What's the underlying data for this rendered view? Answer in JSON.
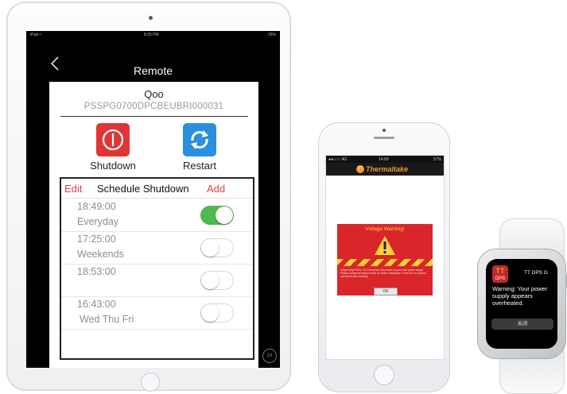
{
  "ipad": {
    "status": {
      "left": "iPad ≈",
      "time": "8:25 PM",
      "right": "25%"
    },
    "nav_title": "Remote",
    "device_name": "Qoo",
    "device_serial": "PSSPG0700DPCBEUBRI000031",
    "actions": {
      "shutdown": "Shutdown",
      "restart": "Restart"
    },
    "schedule": {
      "edit": "Edit",
      "title": "Schedule Shutdown",
      "add": "Add",
      "rows": [
        {
          "time": "18:49:00",
          "days": "Everyday",
          "enabled": true
        },
        {
          "time": "17:25:00",
          "days": "Weekends",
          "enabled": false
        },
        {
          "time": "18:53:00",
          "days": "",
          "enabled": false
        },
        {
          "time": "16:43:00",
          "days": "Wed Thu Fri",
          "enabled": false
        }
      ]
    },
    "zoom_badge": "1X"
  },
  "iphone": {
    "status": {
      "left": "●●○○○ 4G",
      "time": "14:00",
      "right": "57%"
    },
    "brand": "Thermaltake",
    "brand_logo": "TT",
    "warning": {
      "title": "Voltage Warning!",
      "body": "Output stop:PSU's +12V abnormal, which wire on your read power supply. Please contact technical service for further assistance. Press OK to continue operations after warning.",
      "ok": "OK"
    }
  },
  "watch": {
    "icon_tt": "TT",
    "icon_dps": "DPS",
    "app_name": "TT DPS G",
    "message": "Warning: Your power supply appears overheated.",
    "dismiss": "关闭"
  },
  "colors": {
    "shutdown": "#e03535",
    "restart": "#2a8fe0",
    "accent_red": "#e0414b",
    "toggle_on": "#4fb84f",
    "tt_orange": "#f39a1e"
  }
}
